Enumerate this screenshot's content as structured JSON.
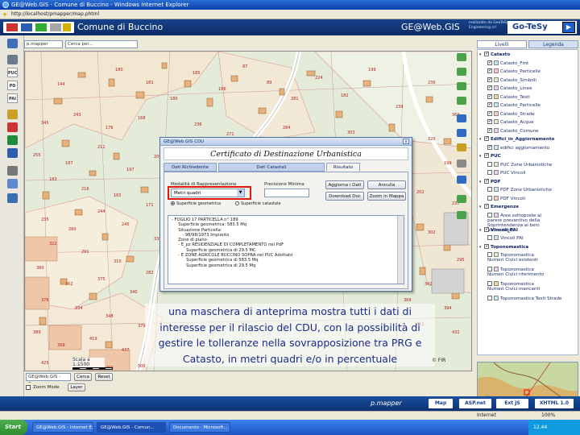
{
  "browser": {
    "title": "GE@Web.GIS - Comune di Buccino - Windows Internet Explorer",
    "url": "http://localhost/pmapper/map.phtml"
  },
  "header": {
    "comune": "Comune di Buccino",
    "product": "GE@Web.GIS",
    "brand_text": "realizzato da GeoTeSy Engineering srl",
    "brand": "Go-TeSy"
  },
  "left_tools": [
    "PUC",
    "PD",
    "PAI"
  ],
  "search": {
    "layer_select": "p.mapper",
    "input_value": "Cerca per..."
  },
  "map_labels": [
    "144",
    "180",
    "181",
    "180",
    "185",
    "186",
    "87",
    "89",
    "281",
    "224",
    "182",
    "199",
    "239",
    "236",
    "363",
    "345",
    "243",
    "176",
    "168",
    "236",
    "271",
    "284",
    "303",
    "371",
    "320",
    "255",
    "187",
    "211",
    "197",
    "209",
    "247",
    "199",
    "183",
    "216",
    "165",
    "171",
    "202",
    "237",
    "235",
    "280",
    "244",
    "245",
    "336",
    "322",
    "291",
    "310",
    "282",
    "302",
    "295",
    "380",
    "362",
    "375",
    "340",
    "378",
    "334",
    "348",
    "379",
    "389",
    "399",
    "419",
    "437",
    "342",
    "368",
    "394",
    "411",
    "432",
    "425",
    "453",
    "469",
    "500"
  ],
  "dialog": {
    "title": "GE@Web.GIS CDU",
    "close": "x",
    "heading": "Certificato di Destinazione Urbanistica",
    "tabs": [
      "Dati Richiedente",
      "Dati Catastali",
      "Risultato"
    ],
    "mode_label": "Modalità di Rappresentazione",
    "mode_value": "Metri quadri",
    "min_label": "Precisione Minima",
    "radio1": "Superficie geometrica",
    "radio2": "Superficie catastale",
    "btn_update": "Aggiorna i Dati",
    "btn_cancel": "Annulla",
    "btn_download": "Download Doc",
    "btn_zoom": "Zoom in Mappa",
    "result_lines": [
      "- FOGLIO 17 PARTICELLA n° 189",
      "     Superficie geometrica: 583.5 Mq",
      "     Situazione Particella:",
      "        - 98/98/1973 Impianto",
      "",
      "     Zone di piano",
      "     - E_pz RESIDENZIALE DI COMPLETAMENTO nel PdF",
      "           Superficie geometrica di 29.5 MC",
      "     - E ZONE AGRICOLE BUCCINO SOPRA nel PUC Adottato",
      "           Superficie geometrica di 583.5 Mq",
      "           Superficie geometrica di 29.5 Mq"
    ]
  },
  "caption": "una maschera di anteprima mostra tutti i dati di interesse per il rilascio del CDU, con la possibilità di gestire le tolleranze nella sovrapposizione tra PRG e Catasto, in metri quadri e/o in percentuale",
  "scale": {
    "label": "Scala a",
    "value": "1:1500"
  },
  "copyright": "© FIR",
  "bottom": {
    "search_input": "GE@Web.GIS - Cerca per...",
    "btn_cerca": "Cerca",
    "btn_reset": "Reset",
    "zoom_mode": "Zoom Mode",
    "btn_layer": "Layer"
  },
  "right_panel": {
    "tabs": [
      "Livelli",
      "Legenda"
    ],
    "layers": [
      {
        "label": "Catasto",
        "group": true,
        "checked": true
      },
      {
        "label": "Catasto_Fmt",
        "checked": true,
        "indent": true
      },
      {
        "label": "Catasto_Particelle",
        "checked": true,
        "indent": true
      },
      {
        "label": "Catasto_Simboli",
        "checked": true,
        "indent": true
      },
      {
        "label": "Catasto_Linee",
        "checked": true,
        "indent": true
      },
      {
        "label": "Catasto_Testi",
        "checked": true,
        "indent": true
      },
      {
        "label": "Catasto_Particelle",
        "checked": true,
        "indent": true
      },
      {
        "label": "Catasto_Strade",
        "checked": true,
        "indent": true
      },
      {
        "label": "Catasto_Acque",
        "checked": true,
        "indent": true
      },
      {
        "label": "Catasto_Comune",
        "checked": true,
        "indent": true
      },
      {
        "label": "Edifici_in_Aggiornamento",
        "group": true,
        "checked": true
      },
      {
        "label": "edifici aggiornamento",
        "checked": true,
        "indent": true
      },
      {
        "label": "PUC",
        "group": true,
        "checked": true
      },
      {
        "label": "PUC Zone Urbanistiche",
        "checked": false,
        "indent": true
      },
      {
        "label": "PUC Vincoli",
        "checked": false,
        "indent": true
      },
      {
        "label": "PDF",
        "group": true,
        "checked": true
      },
      {
        "label": "PDF Zone Urbanistiche",
        "checked": false,
        "indent": true
      },
      {
        "label": "PDF Vincoli",
        "checked": false,
        "indent": true
      },
      {
        "label": "Emergenze",
        "group": true,
        "checked": true
      },
      {
        "label": "Aree sottoposte al parere preventivo della Soprintendenza ai beni archeologici",
        "checked": false,
        "indent": true,
        "multi": true
      },
      {
        "label": "Vincoli_PAI",
        "group": true,
        "checked": true
      },
      {
        "label": "Vincoli PAI",
        "checked": false,
        "indent": true
      },
      {
        "label": "Toponomastica",
        "group": true,
        "checked": true
      },
      {
        "label": "Toponomastica Numeri Civici esistenti",
        "checked": false,
        "indent": true,
        "multi": true
      },
      {
        "label": "Toponomastica Numeri Civici riferimento",
        "checked": false,
        "indent": true,
        "multi": true
      },
      {
        "label": "Toponomastica Numeri Civici mancanti",
        "checked": false,
        "indent": true,
        "multi": true
      },
      {
        "label": "Toponomastica Testi Strade",
        "checked": false,
        "indent": true
      }
    ]
  },
  "footer": {
    "pmapper": "p.mapper",
    "badges": [
      "Map Server",
      "ASP.net",
      "Ext JS",
      "XHTML 1.0"
    ]
  },
  "statusbar": {
    "internet": "Internet",
    "zoom": "100%"
  },
  "taskbar": {
    "start": "Start",
    "tasks": [
      "GE@Web.GIS - Internet Ex...",
      "GE@Web.GIS - Comun...",
      "Documento - Microsoft..."
    ],
    "clock": "12.44"
  },
  "colors": {
    "header_bg": "#0b2c66",
    "caption_text": "#1b2a8a",
    "highlight_red": "#e3170a",
    "parcel_orange": "#e8b07a"
  }
}
